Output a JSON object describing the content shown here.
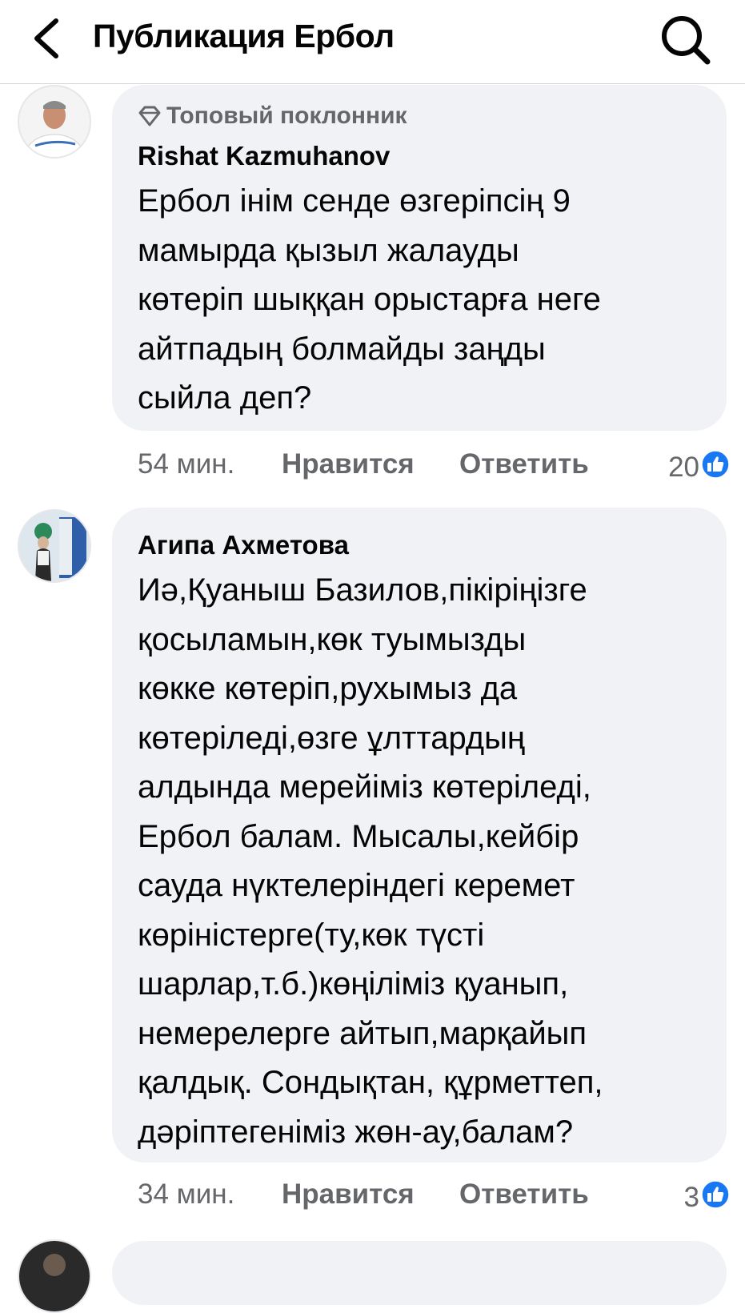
{
  "header": {
    "title": "Публикация Ербол"
  },
  "comments": [
    {
      "badge": "Топовый поклонник",
      "author": "Rishat Kazmuhanov",
      "text": "Ербол інім сенде өзгеріпсің 9\nмамырда қызыл жалауды\nкөтеріп шыққан орыстарға неге\nайтпадың болмайды заңды\nсыйла деп?",
      "time": "54 мин.",
      "like_label": "Нравится",
      "reply_label": "Ответить",
      "reactions": "20"
    },
    {
      "author": "Агипа Ахметова",
      "text": "Иә,Қуаныш Базилов,пікіріңізге\nқосыламын,көк туымызды\nкөкке көтеріп,рухымыз да\nкөтеріледі,өзге ұлттардың\nалдында мерейіміз көтеріледі,\nЕрбол балам. Мысалы,кейбір\nсауда нүктелеріндегі керемет\nкөріністерге(ту,көк түсті\nшарлар,т.б.)көңіліміз қуанып,\nнемерелерге айтып,марқайып\nқалдық. Сондықтан, құрметтеп,\nдәріптегеніміз жөн-ау,балам?",
      "time": "34 мин.",
      "like_label": "Нравится",
      "reply_label": "Ответить",
      "reactions": "3"
    }
  ],
  "colors": {
    "accent": "#1877f2",
    "bubble": "#f0f2f5",
    "secondary_text": "#65676b"
  },
  "icons": [
    "back-arrow-icon",
    "search-icon",
    "diamond-icon",
    "like-reaction-icon"
  ]
}
